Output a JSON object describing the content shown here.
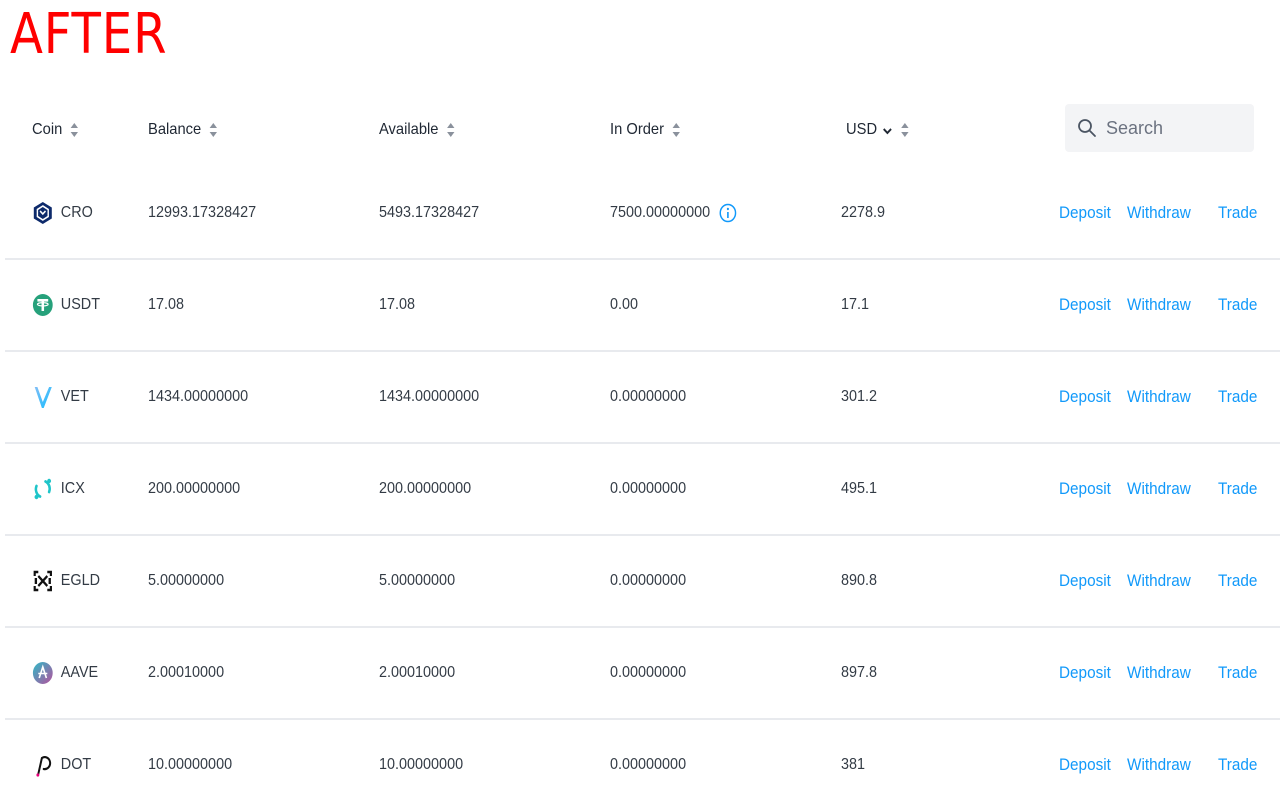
{
  "overlay_label": "AFTER",
  "table": {
    "headers": {
      "coin": "Coin",
      "balance": "Balance",
      "available": "Available",
      "in_order": "In Order",
      "usd": "USD"
    },
    "search": {
      "placeholder": "Search",
      "value": ""
    },
    "actions": {
      "deposit": "Deposit",
      "withdraw": "Withdraw",
      "trade": "Trade"
    },
    "rows": [
      {
        "coin": "CRO",
        "icon": "cro-icon",
        "balance": "12993.17328427",
        "available": "5493.17328427",
        "in_order": "7500.00000000",
        "in_order_info": true,
        "usd": "2278.9"
      },
      {
        "coin": "USDT",
        "icon": "usdt-icon",
        "balance": "17.08",
        "available": "17.08",
        "in_order": "0.00",
        "in_order_info": false,
        "usd": "17.1"
      },
      {
        "coin": "VET",
        "icon": "vet-icon",
        "balance": "1434.00000000",
        "available": "1434.00000000",
        "in_order": "0.00000000",
        "in_order_info": false,
        "usd": "301.2"
      },
      {
        "coin": "ICX",
        "icon": "icx-icon",
        "balance": "200.00000000",
        "available": "200.00000000",
        "in_order": "0.00000000",
        "in_order_info": false,
        "usd": "495.1"
      },
      {
        "coin": "EGLD",
        "icon": "egld-icon",
        "balance": "5.00000000",
        "available": "5.00000000",
        "in_order": "0.00000000",
        "in_order_info": false,
        "usd": "890.8"
      },
      {
        "coin": "AAVE",
        "icon": "aave-icon",
        "balance": "2.00010000",
        "available": "2.00010000",
        "in_order": "0.00000000",
        "in_order_info": false,
        "usd": "897.8"
      },
      {
        "coin": "DOT",
        "icon": "dot-icon",
        "balance": "10.00000000",
        "available": "10.00000000",
        "in_order": "0.00000000",
        "in_order_info": false,
        "usd": "381"
      }
    ]
  },
  "colors": {
    "overlay_label": "#ff0000",
    "link": "#1199fa",
    "text": "#333b45",
    "divider": "#e8eaee",
    "search_bg": "#f3f4f6"
  }
}
